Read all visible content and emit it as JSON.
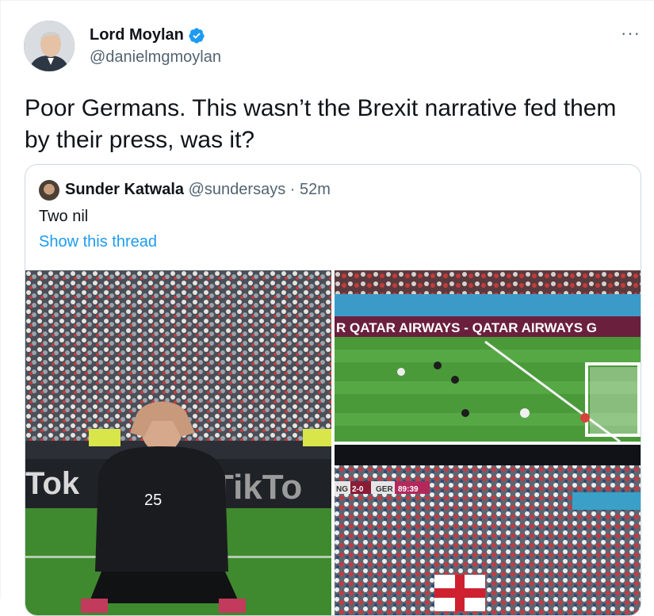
{
  "author": {
    "name": "Lord Moylan",
    "handle": "@danielmgmoylan",
    "verified": true,
    "avatar_icon": "profile-photo"
  },
  "more_label": "···",
  "tweet": {
    "text": "Poor Germans. This wasn’t the Brexit narrative fed them by their press, was it?"
  },
  "quote": {
    "name": "Sunder Katwala",
    "handle": "@sundersays",
    "separator": " · ",
    "time": "52m",
    "text": "Two nil",
    "show_thread": "Show this thread"
  },
  "media": {
    "left": {
      "sign_text": "Tok",
      "sign_text2": "TikTo",
      "shirt_number": "25"
    },
    "top_right": {
      "banner": "R QATAR AIRWAYS - QATAR AIRWAYS G"
    },
    "bottom_right": {
      "score_left": "NG",
      "score": "2-0",
      "score_right": "GER",
      "clock": "89:39"
    }
  },
  "colors": {
    "accent": "#1d9bf0",
    "text": "#0f1419",
    "muted": "#536471",
    "border": "#cfd9de"
  }
}
